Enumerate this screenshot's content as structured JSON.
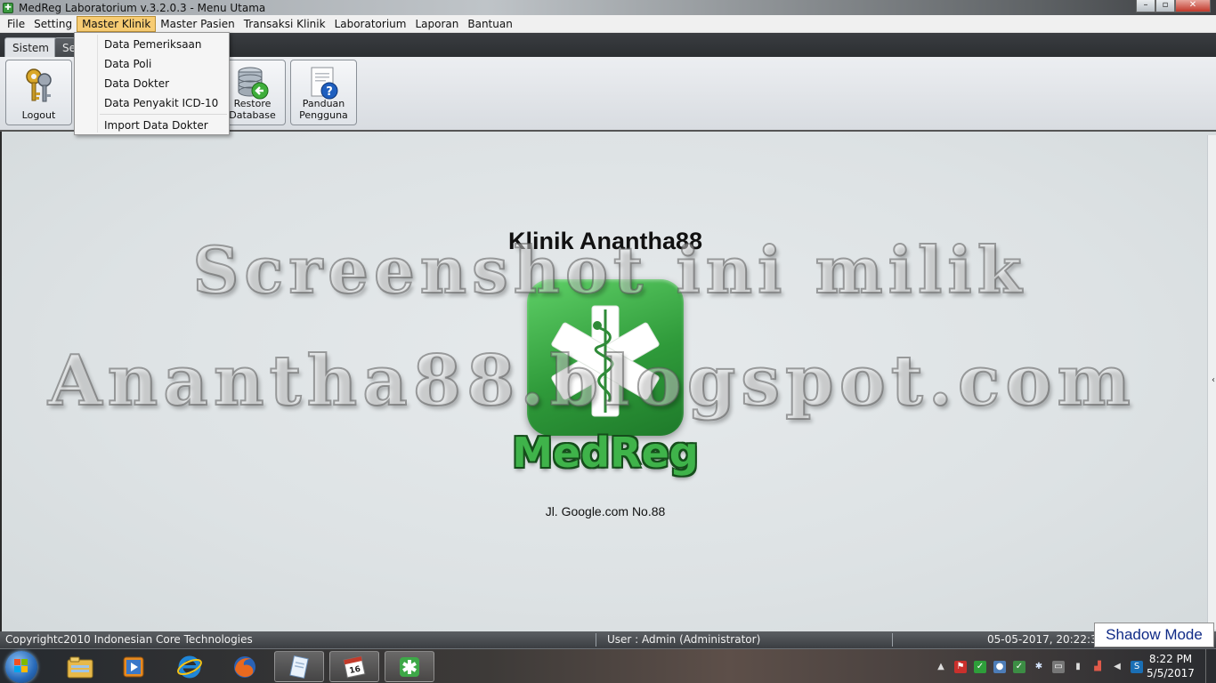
{
  "window": {
    "title": "MedReg Laboratorium v.3.2.0.3 - Menu Utama",
    "controls": [
      "minimize",
      "maximize",
      "close"
    ]
  },
  "menubar": {
    "items": [
      "File",
      "Setting",
      "Master Klinik",
      "Master Pasien",
      "Transaksi Klinik",
      "Laboratorium",
      "Laporan",
      "Bantuan"
    ],
    "active": "Master Klinik"
  },
  "dropdown": {
    "items": [
      "Data Pemeriksaan",
      "Data Poli",
      "Data Dokter",
      "Data Penyakit ICD-10",
      "Import Data Dokter"
    ]
  },
  "ribbon": {
    "tabs": [
      "Sistem",
      "Se"
    ],
    "buttons": {
      "logout": "Logout",
      "restore": [
        "Restore",
        "Database"
      ],
      "panduan": [
        "Panduan",
        "Pengguna"
      ]
    }
  },
  "main": {
    "clinic_name": "Klinik Anantha88",
    "brand": "MedReg",
    "address": "Jl. Google.com No.88",
    "watermark_line1": "Screenshot ini milik",
    "watermark_line2": "Anantha88.blogspot.com"
  },
  "statusbar": {
    "copyright": "Copyrightc2010 Indonesian Core Technologies",
    "user": "User : Admin (Administrator)",
    "datetime": "05-05-2017, 20:22:35"
  },
  "shadow_mode": "Shadow Mode",
  "taskbar": {
    "clock_time": "8:22 PM",
    "clock_date": "5/5/2017",
    "calendar_day": "16",
    "pinned": [
      "windows-explorer",
      "media-player",
      "internet-explorer",
      "firefox",
      "notepad",
      "calendar",
      "medreg"
    ]
  },
  "colors": {
    "menu_highlight": "#f7cc73",
    "brand_green": "#3fb34a",
    "shadow_mode_text": "#0f2a86"
  }
}
